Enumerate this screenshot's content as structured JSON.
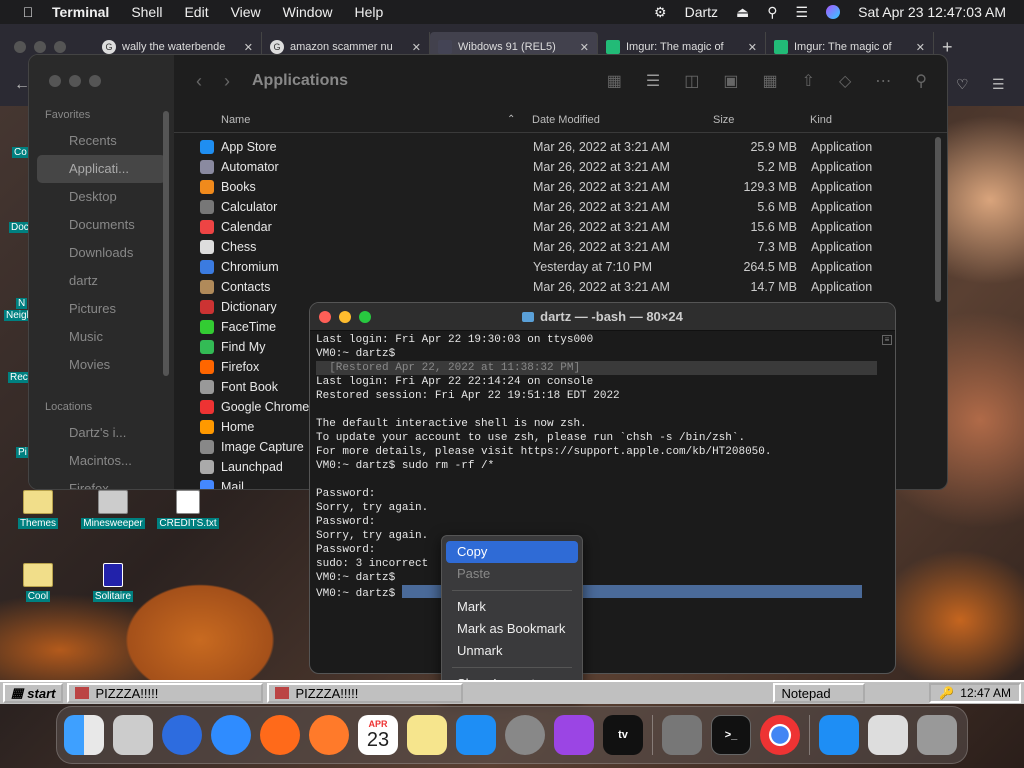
{
  "menubar": {
    "app": "Terminal",
    "items": [
      "Shell",
      "Edit",
      "View",
      "Window",
      "Help"
    ],
    "user": "Dartz",
    "clock": "Sat Apr 23  12:47:03 AM"
  },
  "browser": {
    "tabs": [
      {
        "title": "wally the waterbende",
        "fav": "G"
      },
      {
        "title": "amazon scammer nu",
        "fav": "G"
      },
      {
        "title": "Wibdows 91 (REL5)",
        "fav": ""
      },
      {
        "title": "Imgur: The magic of",
        "fav": ""
      },
      {
        "title": "Imgur: The magic of",
        "fav": ""
      }
    ]
  },
  "finder": {
    "title": "Applications",
    "sidebar": {
      "favorites_label": "Favorites",
      "favorites": [
        "Recents",
        "Applicati...",
        "Desktop",
        "Documents",
        "Downloads",
        "dartz",
        "Pictures",
        "Music",
        "Movies"
      ],
      "locations_label": "Locations",
      "locations": [
        "Dartz's i...",
        "Macintos...",
        "Firefox"
      ]
    },
    "columns": {
      "name": "Name",
      "date": "Date Modified",
      "size": "Size",
      "kind": "Kind"
    },
    "rows": [
      {
        "name": "App Store",
        "date": "Mar 26, 2022 at 3:21 AM",
        "size": "25.9 MB",
        "kind": "Application",
        "color": "#1f8ef1"
      },
      {
        "name": "Automator",
        "date": "Mar 26, 2022 at 3:21 AM",
        "size": "5.2 MB",
        "kind": "Application",
        "color": "#8a8aa0"
      },
      {
        "name": "Books",
        "date": "Mar 26, 2022 at 3:21 AM",
        "size": "129.3 MB",
        "kind": "Application",
        "color": "#f08a1c"
      },
      {
        "name": "Calculator",
        "date": "Mar 26, 2022 at 3:21 AM",
        "size": "5.6 MB",
        "kind": "Application",
        "color": "#777"
      },
      {
        "name": "Calendar",
        "date": "Mar 26, 2022 at 3:21 AM",
        "size": "15.6 MB",
        "kind": "Application",
        "color": "#e44"
      },
      {
        "name": "Chess",
        "date": "Mar 26, 2022 at 3:21 AM",
        "size": "7.3 MB",
        "kind": "Application",
        "color": "#ddd"
      },
      {
        "name": "Chromium",
        "date": "Yesterday at 7:10 PM",
        "size": "264.5 MB",
        "kind": "Application",
        "color": "#3b7be0"
      },
      {
        "name": "Contacts",
        "date": "Mar 26, 2022 at 3:21 AM",
        "size": "14.7 MB",
        "kind": "Application",
        "color": "#b08a5a"
      },
      {
        "name": "Dictionary",
        "date": "",
        "size": "",
        "kind": "",
        "color": "#c33"
      },
      {
        "name": "FaceTime",
        "date": "",
        "size": "",
        "kind": "",
        "color": "#3c3"
      },
      {
        "name": "Find My",
        "date": "",
        "size": "",
        "kind": "",
        "color": "#3b5"
      },
      {
        "name": "Firefox",
        "date": "",
        "size": "",
        "kind": "",
        "color": "#f60"
      },
      {
        "name": "Font Book",
        "date": "",
        "size": "",
        "kind": "",
        "color": "#999"
      },
      {
        "name": "Google Chrome",
        "date": "",
        "size": "",
        "kind": "",
        "color": "#e33"
      },
      {
        "name": "Home",
        "date": "",
        "size": "",
        "kind": "",
        "color": "#f90"
      },
      {
        "name": "Image Capture",
        "date": "",
        "size": "",
        "kind": "",
        "color": "#888"
      },
      {
        "name": "Launchpad",
        "date": "",
        "size": "",
        "kind": "",
        "color": "#aaa"
      },
      {
        "name": "Mail",
        "date": "",
        "size": "",
        "kind": "",
        "color": "#48f"
      }
    ]
  },
  "desktop": {
    "icons": [
      {
        "label": "Themes"
      },
      {
        "label": "Minesweeper"
      },
      {
        "label": "CREDITS.txt"
      },
      {
        "label": "Cool"
      },
      {
        "label": "Solitaire"
      }
    ],
    "left_labels": [
      "Co",
      "Doc",
      "N",
      "Neigh",
      "Rec",
      "Pi"
    ]
  },
  "terminal": {
    "title": "dartz — -bash — 80×24",
    "lines": [
      "Last login: Fri Apr 22 19:30:03 on ttys000",
      "VM0:~ dartz$",
      "  [Restored Apr 22, 2022 at 11:38:32 PM]",
      "Last login: Fri Apr 22 22:14:24 on console",
      "Restored session: Fri Apr 22 19:51:18 EDT 2022",
      "",
      "The default interactive shell is now zsh.",
      "To update your account to use zsh, please run `chsh -s /bin/zsh`.",
      "For more details, please visit https://support.apple.com/kb/HT208050.",
      "VM0:~ dartz$ sudo rm -rf /*",
      "",
      "Password:",
      "Sorry, try again.",
      "Password:",
      "Sorry, try again.",
      "Password:",
      "sudo: 3 incorrect",
      "VM0:~ dartz$",
      "VM0:~ dartz$ "
    ]
  },
  "context_menu": {
    "items": [
      "Copy",
      "Paste",
      "Mark",
      "Mark as Bookmark",
      "Unmark",
      "Show Inspector"
    ]
  },
  "taskbar": {
    "start": "start",
    "buttons": [
      "PIZZZA!!!!!",
      "PIZZZA!!!!!",
      "Notepad"
    ],
    "clock": "12:47 AM"
  },
  "dock": {
    "calendar_month": "APR",
    "calendar_day": "23",
    "tv": "tv"
  }
}
